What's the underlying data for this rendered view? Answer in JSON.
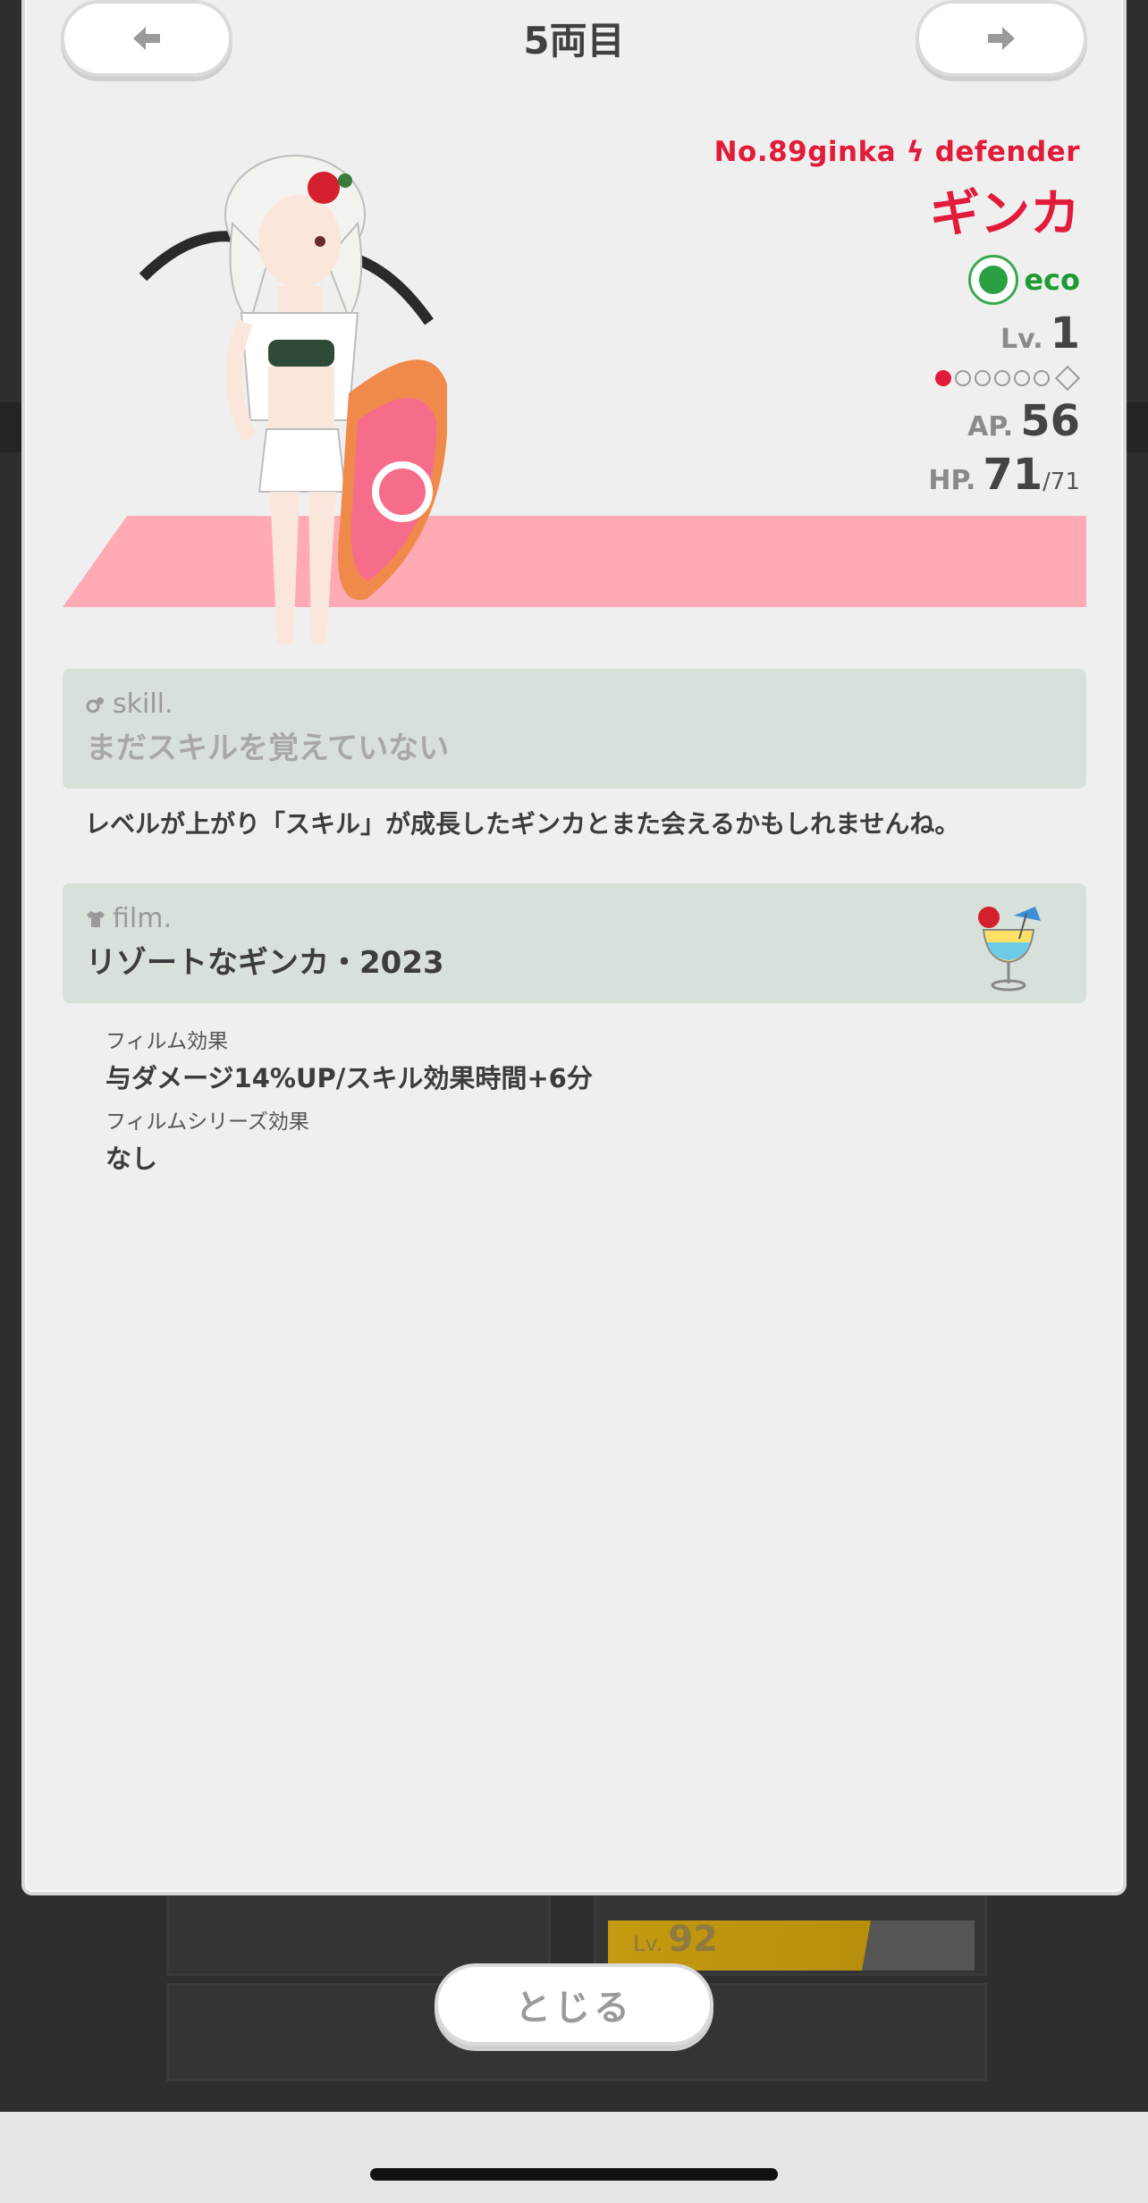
{
  "header": {
    "title": "5両目",
    "prev_icon": "arrow-left-icon",
    "next_icon": "arrow-right-icon"
  },
  "character": {
    "code": "No.89ginka ϟ defender",
    "name": "ギンカ",
    "attribute": "eco",
    "level_label": "Lv.",
    "level": "1",
    "rank_filled": 1,
    "rank_total": 6,
    "ap_label": "AP.",
    "ap": "56",
    "hp_label": "HP.",
    "hp": "71",
    "hp_max": "/71"
  },
  "skill": {
    "label": "skill.",
    "value": "まだスキルを覚えていない"
  },
  "note": "レベルが上がり「スキル」が成長したギンカとまた会えるかもしれませんね。",
  "film": {
    "label": "film.",
    "value": "リゾートなギンカ・2023",
    "effects": [
      {
        "label": "フィルム効果",
        "value": "与ダメージ14%UP/スキル効果時間+6分"
      },
      {
        "label": "フィルムシリーズ効果",
        "value": "なし"
      }
    ]
  },
  "background": {
    "lv_label": "Lv.",
    "lv_value": "92"
  },
  "close_label": "とじる",
  "colors": {
    "accent_red": "#e11b3a",
    "eco_green": "#1e9a32",
    "band_pink": "#ffaab4",
    "panel_bg": "#d8e0da"
  }
}
